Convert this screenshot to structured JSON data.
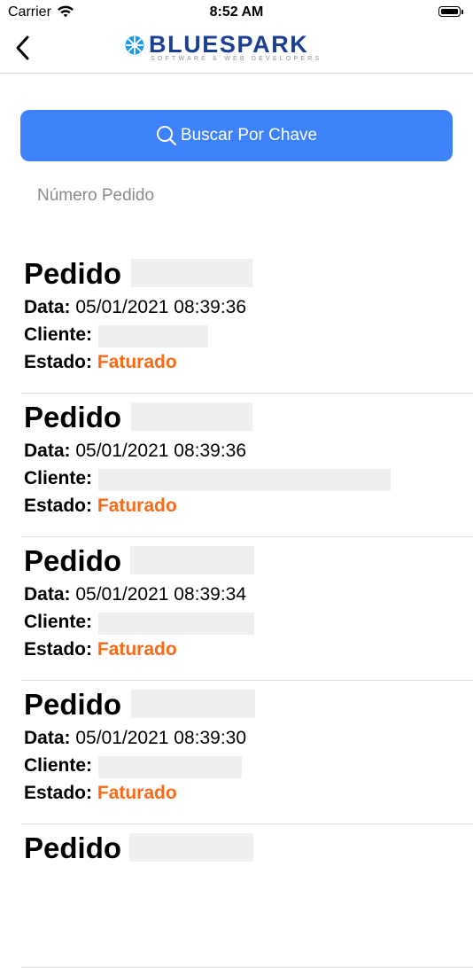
{
  "status_bar": {
    "carrier": "Carrier",
    "time": "8:52 AM",
    "battery_level": 1.0
  },
  "header": {
    "back_icon": "chevron-left-icon",
    "logo_name": "BLUESPARK",
    "logo_tagline": "SOFTWARE & WEB DEVELOPERS",
    "brand_color": "#1b3f93",
    "accent_color": "#1e9be8"
  },
  "search": {
    "button_label": "Buscar Por Chave",
    "button_icon": "search-icon",
    "button_color": "#3d82fa",
    "input_placeholder": "Número Pedido",
    "input_value": ""
  },
  "labels": {
    "order": "Pedido",
    "date": "Data:",
    "client": "Cliente:",
    "status": "Estado:"
  },
  "status_color": "#f96a17",
  "orders": [
    {
      "date": "05/01/2021 08:39:36",
      "status": "Faturado"
    },
    {
      "date": "05/01/2021 08:39:36",
      "status": "Faturado"
    },
    {
      "date": "05/01/2021 08:39:34",
      "status": "Faturado"
    },
    {
      "date": "05/01/2021 08:39:30",
      "status": "Faturado"
    }
  ]
}
